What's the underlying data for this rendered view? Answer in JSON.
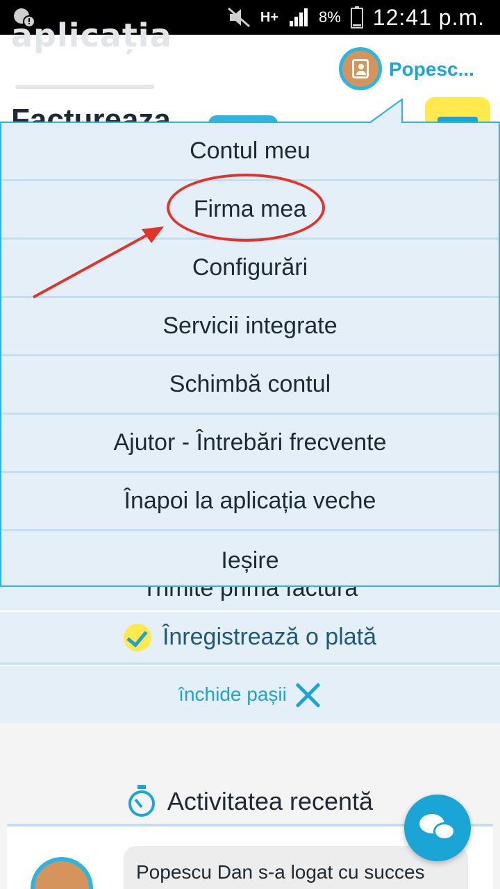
{
  "status_bar": {
    "network": "H+",
    "battery_percent": "8%",
    "time": "12:41 p.m."
  },
  "header": {
    "logo_text": "aplicația",
    "user_name": "Popesc..."
  },
  "background_page": {
    "title_fragment": "Factureaza",
    "partial_step": "Trimite prima factura"
  },
  "menu": {
    "items": [
      {
        "label": "Contul meu"
      },
      {
        "label": "Firma mea"
      },
      {
        "label": "Configurări"
      },
      {
        "label": "Servicii integrate"
      },
      {
        "label": "Schimbă contul"
      },
      {
        "label": "Ajutor - Întrebări frecvente"
      },
      {
        "label": "Înapoi la aplicația veche"
      },
      {
        "label": "Ieșire"
      }
    ],
    "highlighted_item": "Firma mea"
  },
  "steps": {
    "payment_step": "Înregistrează o plată",
    "close_steps": "închide pașii"
  },
  "activity": {
    "title": "Activitatea recentă",
    "items": [
      {
        "text": "Popescu Dan s-a logat cu succes"
      }
    ]
  },
  "colors": {
    "accent": "#2cb4e2",
    "menu_bg": "#e4eff7",
    "annotation_red": "#e2332b",
    "yellow": "#ffe94d"
  }
}
